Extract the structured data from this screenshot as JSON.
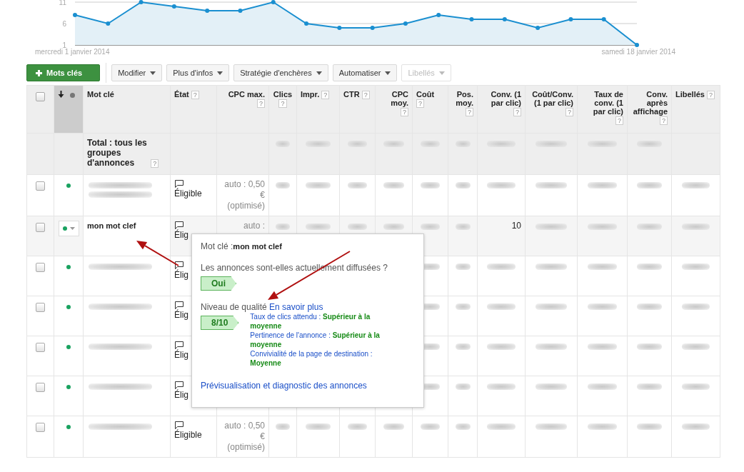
{
  "chart": {
    "chart_data": {
      "type": "area",
      "categories": [
        "mercredi 1 janvier 2014",
        null,
        null,
        null,
        null,
        null,
        null,
        null,
        null,
        null,
        null,
        null,
        null,
        null,
        null,
        null,
        null,
        "samedi 18 janvier 2014"
      ],
      "series": [
        {
          "color": "#1a8fd0",
          "values": [
            8,
            6,
            11,
            10,
            9,
            9,
            11,
            6,
            5,
            5,
            6,
            8,
            7,
            7,
            5,
            7,
            7,
            1
          ]
        }
      ],
      "ylim": [
        1,
        11
      ],
      "yticks": [
        1,
        6,
        11
      ]
    }
  },
  "toolbar": [
    {
      "kind": "primary",
      "label": "Mots clés"
    },
    {
      "kind": "menu",
      "label": "Modifier",
      "disabled": false
    },
    {
      "kind": "menu",
      "label": "Plus d'infos",
      "disabled": false
    },
    {
      "kind": "menu",
      "label": "Stratégie d'enchères",
      "disabled": false
    },
    {
      "kind": "menu",
      "label": "Automatiser",
      "disabled": false
    },
    {
      "kind": "menu",
      "label": "Libellés",
      "disabled": true
    }
  ],
  "table": {
    "columns": [
      {
        "kind": "check",
        "checked": false
      },
      {
        "kind": "status",
        "sorted": true
      },
      {
        "kind": "text",
        "label": "Mot clé"
      },
      {
        "kind": "text",
        "label": "État",
        "help": "?"
      },
      {
        "kind": "text",
        "label": "CPC max.",
        "help": "?"
      },
      {
        "kind": "text",
        "label": "Clics",
        "help": "?"
      },
      {
        "kind": "text",
        "label": "Impr.",
        "help": "?"
      },
      {
        "kind": "text",
        "label": "CTR",
        "help": "?"
      },
      {
        "kind": "text",
        "label": "CPC moy.",
        "help": "?"
      },
      {
        "kind": "text",
        "label": "Coût",
        "help": "?"
      },
      {
        "kind": "text",
        "label": "Pos. moy.",
        "help": "?"
      },
      {
        "kind": "text",
        "label": "Conv. (1 par clic)",
        "help": "?"
      },
      {
        "kind": "text",
        "label": "Coût/Conv. (1 par clic)",
        "help": "?"
      },
      {
        "kind": "text",
        "label": "Taux de conv. (1 par clic)",
        "help": "?"
      },
      {
        "kind": "text",
        "label": "Conv. après affichage",
        "help": "?"
      },
      {
        "kind": "text",
        "label": "Libellés",
        "help": "?"
      }
    ],
    "total": {
      "label": "Total : tous les groupes d'annonces",
      "help": "?",
      "values": [
        {
          "kind": "blurred"
        },
        {
          "kind": "blurred"
        },
        {
          "kind": "blurred"
        },
        {
          "kind": "blurred"
        },
        {
          "kind": "blurred"
        },
        {
          "kind": "blurred"
        },
        {
          "kind": "blurred"
        },
        {
          "kind": "blurred"
        },
        {
          "kind": "blurred"
        },
        {
          "kind": "blurred"
        },
        {
          "kind": "empty"
        }
      ]
    },
    "rows": [
      {
        "checked": false,
        "selected": false,
        "color": "#1aa260",
        "keyword": {
          "kind": "blurred"
        },
        "state": "Éligible",
        "cpc": "auto : 0,50 € (optimisé)",
        "values": [
          {
            "kind": "blurred"
          },
          {
            "kind": "blurred"
          },
          {
            "kind": "blurred"
          },
          {
            "kind": "blurred"
          },
          {
            "kind": "blurred"
          },
          {
            "kind": "blurred"
          },
          {
            "kind": "blurred"
          },
          {
            "kind": "blurred"
          },
          {
            "kind": "blurred"
          },
          {
            "kind": "blurred"
          },
          {
            "kind": "blurred"
          }
        ]
      },
      {
        "checked": false,
        "selected": true,
        "color": "#1aa260",
        "keyword": {
          "kind": "text",
          "text": "mon mot clef"
        },
        "state": "Élig",
        "cpc": "auto :",
        "values": [
          {
            "kind": "blurred"
          },
          {
            "kind": "blurred"
          },
          {
            "kind": "blurred"
          },
          {
            "kind": "blurred"
          },
          {
            "kind": "blurred"
          },
          {
            "kind": "blurred"
          },
          {
            "kind": "text",
            "text": "10"
          },
          {
            "kind": "blurred"
          },
          {
            "kind": "blurred"
          },
          {
            "kind": "blurred"
          },
          {
            "kind": "blurred"
          }
        ]
      },
      {
        "checked": false,
        "selected": false,
        "color": "#1aa260",
        "keyword": {
          "kind": "blurred"
        },
        "state": "Élig",
        "values": [
          {
            "kind": "empty"
          },
          {
            "kind": "empty"
          },
          {
            "kind": "empty"
          },
          {
            "kind": "empty"
          },
          {
            "kind": "blurred"
          },
          {
            "kind": "blurred"
          },
          {
            "kind": "blurred"
          },
          {
            "kind": "blurred"
          },
          {
            "kind": "blurred"
          },
          {
            "kind": "blurred"
          },
          {
            "kind": "blurred"
          }
        ]
      },
      {
        "checked": false,
        "selected": false,
        "color": "#1aa260",
        "keyword": {
          "kind": "blurred"
        },
        "state": "Élig",
        "values": [
          {
            "kind": "empty"
          },
          {
            "kind": "empty"
          },
          {
            "kind": "empty"
          },
          {
            "kind": "empty"
          },
          {
            "kind": "blurred"
          },
          {
            "kind": "blurred"
          },
          {
            "kind": "blurred"
          },
          {
            "kind": "blurred"
          },
          {
            "kind": "blurred"
          },
          {
            "kind": "blurred"
          },
          {
            "kind": "blurred"
          }
        ]
      },
      {
        "checked": false,
        "selected": false,
        "color": "#1aa260",
        "keyword": {
          "kind": "blurred"
        },
        "state": "Élig",
        "values": [
          {
            "kind": "empty"
          },
          {
            "kind": "empty"
          },
          {
            "kind": "empty"
          },
          {
            "kind": "empty"
          },
          {
            "kind": "blurred"
          },
          {
            "kind": "blurred"
          },
          {
            "kind": "blurred"
          },
          {
            "kind": "blurred"
          },
          {
            "kind": "blurred"
          },
          {
            "kind": "blurred"
          },
          {
            "kind": "blurred"
          }
        ]
      },
      {
        "checked": false,
        "selected": false,
        "color": "#1aa260",
        "keyword": {
          "kind": "blurred"
        },
        "state": "Élig",
        "values": [
          {
            "kind": "empty"
          },
          {
            "kind": "empty"
          },
          {
            "kind": "empty"
          },
          {
            "kind": "empty"
          },
          {
            "kind": "blurred"
          },
          {
            "kind": "blurred"
          },
          {
            "kind": "blurred"
          },
          {
            "kind": "blurred"
          },
          {
            "kind": "blurred"
          },
          {
            "kind": "blurred"
          },
          {
            "kind": "blurred"
          }
        ]
      },
      {
        "checked": false,
        "selected": false,
        "color": "#1aa260",
        "keyword": {
          "kind": "blurred"
        },
        "state": "Éligible",
        "cpc": "auto : 0,50 € (optimisé)",
        "values": [
          {
            "kind": "blurred"
          },
          {
            "kind": "blurred"
          },
          {
            "kind": "blurred"
          },
          {
            "kind": "blurred"
          },
          {
            "kind": "blurred"
          },
          {
            "kind": "blurred"
          },
          {
            "kind": "blurred"
          },
          {
            "kind": "blurred"
          },
          {
            "kind": "blurred"
          },
          {
            "kind": "blurred"
          },
          {
            "kind": "blurred"
          }
        ]
      }
    ]
  },
  "tooltip": {
    "keyword_label": "Mot clé :",
    "keyword": "mon mot clef",
    "question": "Les annonces sont-elles actuellement diffusées ?",
    "serving_badge": "Oui",
    "quality_label": "Niveau de qualité",
    "quality_link": "En savoir plus",
    "quality_badge": "8/10",
    "details": [
      "Taux de clics attendu : **Supérieur à la moyenne**",
      "Pertinence de l'annonce : **Supérieur à la moyenne**",
      "Convivialité de la page de destination : **Moyenne**"
    ],
    "footer_link": "Prévisualisation et diagnostic des annonces"
  }
}
